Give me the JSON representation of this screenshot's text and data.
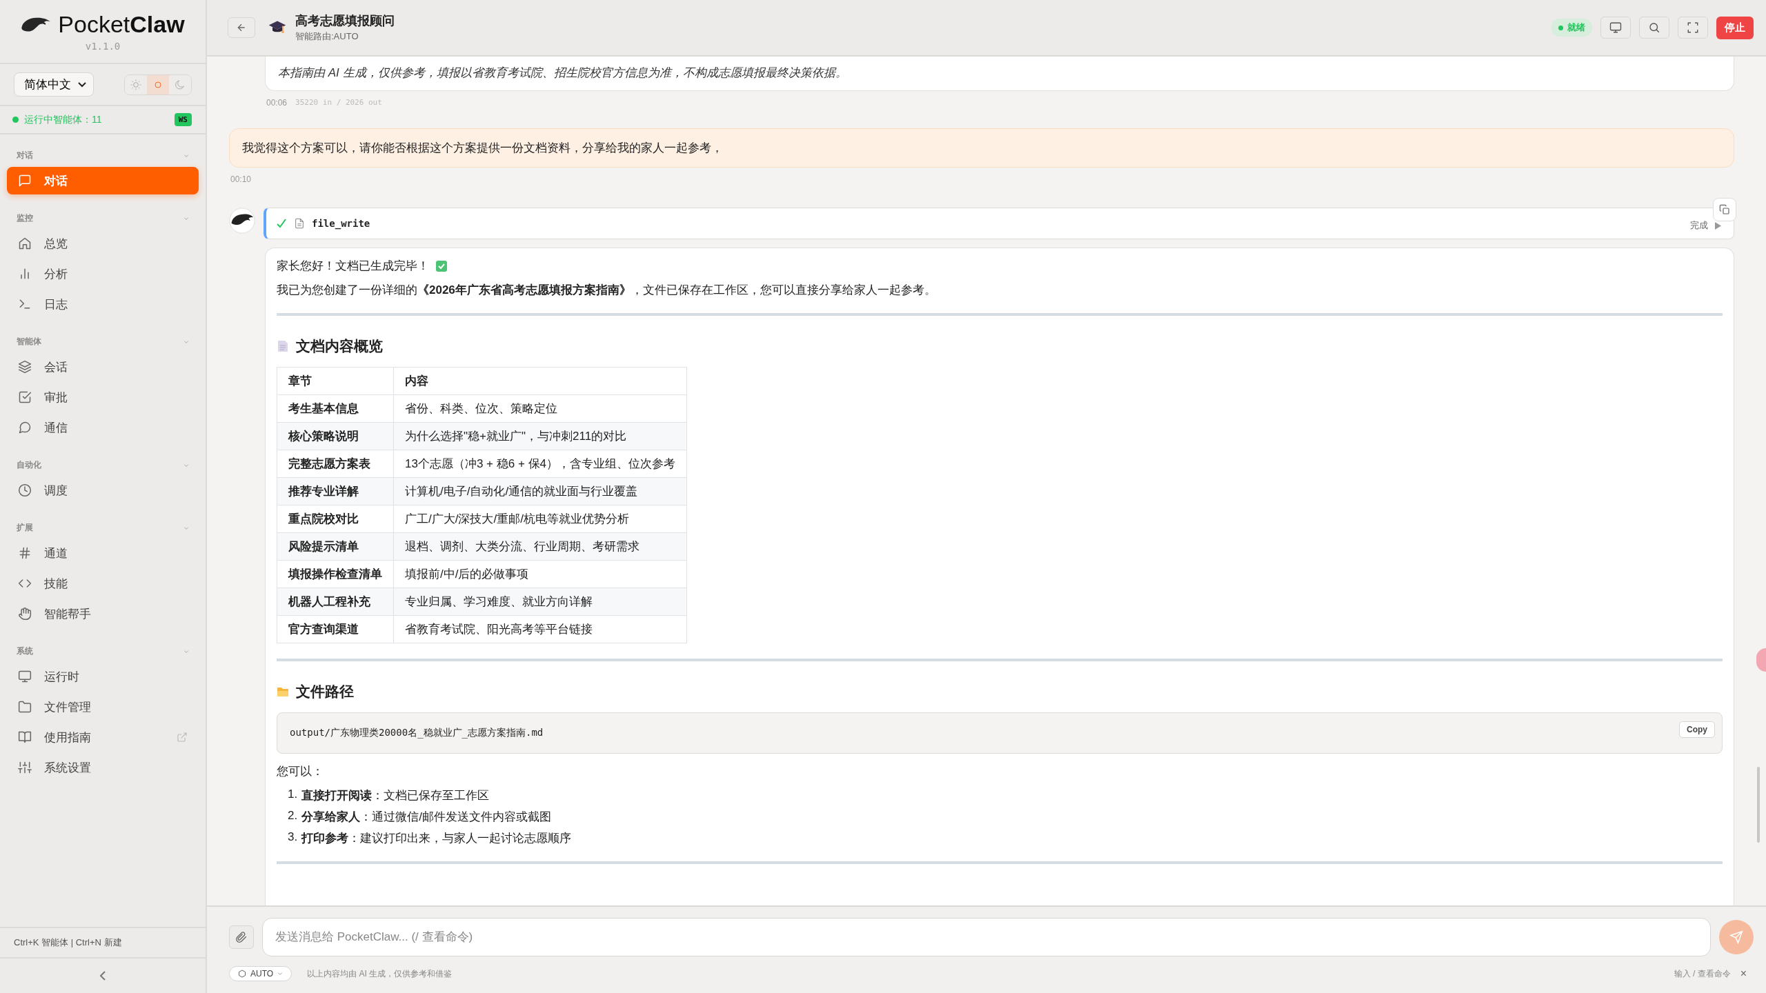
{
  "app": {
    "name_light": "Pocket",
    "name_bold": "Claw",
    "version": "v1.1.0"
  },
  "language": {
    "value": "简体中文"
  },
  "theme_modes": [
    {
      "kind": "light",
      "selected": false
    },
    {
      "kind": "system",
      "selected": true
    },
    {
      "kind": "dark",
      "selected": false
    }
  ],
  "runtime_status": {
    "text": "运行中智能体：11",
    "badge": "WS"
  },
  "sidebar": {
    "sections": [
      {
        "title": "对话",
        "expanded": true,
        "items": [
          {
            "label": "对话",
            "selected": true,
            "external": false
          }
        ]
      },
      {
        "title": "监控",
        "expanded": true,
        "items": [
          {
            "label": "总览",
            "selected": false,
            "external": false
          },
          {
            "label": "分析",
            "selected": false,
            "external": false
          },
          {
            "label": "日志",
            "selected": false,
            "external": false
          }
        ]
      },
      {
        "title": "智能体",
        "expanded": true,
        "items": [
          {
            "label": "会话",
            "selected": false,
            "external": false
          },
          {
            "label": "审批",
            "selected": false,
            "external": false
          },
          {
            "label": "通信",
            "selected": false,
            "external": false
          }
        ]
      },
      {
        "title": "自动化",
        "expanded": true,
        "items": [
          {
            "label": "调度",
            "selected": false,
            "external": false
          }
        ]
      },
      {
        "title": "扩展",
        "expanded": true,
        "items": [
          {
            "label": "通道",
            "selected": false,
            "external": false
          },
          {
            "label": "技能",
            "selected": false,
            "external": false
          },
          {
            "label": "智能帮手",
            "selected": false,
            "external": false
          }
        ]
      },
      {
        "title": "系统",
        "expanded": true,
        "items": [
          {
            "label": "运行时",
            "selected": false,
            "external": false
          },
          {
            "label": "文件管理",
            "selected": false,
            "external": false
          },
          {
            "label": "使用指南",
            "selected": false,
            "external": true
          },
          {
            "label": "系统设置",
            "selected": false,
            "external": false
          }
        ]
      }
    ],
    "shortcuts": "Ctrl+K 智能体 | Ctrl+N 新建"
  },
  "header": {
    "title": "高考志愿填报顾问",
    "subtitle": "智能路由:AUTO",
    "status": "就绪",
    "stop_button": "停止"
  },
  "messages": [
    {
      "kind": "assistant_note",
      "text": "本指南由 AI 生成，仅供参考，填报以省教育考试院、招生院校官方信息为准，不构成志愿填报最终决策依据。",
      "time": "00:06",
      "tokens": "35220 in / 2026 out"
    },
    {
      "kind": "user",
      "text": "我觉得这个方案可以，请你能否根据这个方案提供一份文档资料，分享给我的家人一起参考，",
      "time": "00:10"
    },
    {
      "kind": "tool",
      "name": "file_write",
      "status": "完成",
      "success": true
    },
    {
      "kind": "assistant",
      "greeting": "家长您好！文档已生成完毕！",
      "intro": "我已为您创建了一份详细的**《2026年广东省高考志愿填报方案指南》**，文件已保存在工作区，您可以直接分享给家人一起参考。",
      "overview_heading": "文档内容概览",
      "table": {
        "columns": [
          "章节",
          "内容"
        ],
        "rows": [
          [
            "考生基本信息",
            "省份、科类、位次、策略定位"
          ],
          [
            "核心策略说明",
            "为什么选择\"稳+就业广\"，与冲刺211的对比"
          ],
          [
            "完整志愿方案表",
            "13个志愿（冲3 + 稳6 + 保4），含专业组、位次参考"
          ],
          [
            "推荐专业详解",
            "计算机/电子/自动化/通信的就业面与行业覆盖"
          ],
          [
            "重点院校对比",
            "广工/广大/深技大/重邮/杭电等就业优势分析"
          ],
          [
            "风险提示清单",
            "退档、调剂、大类分流、行业周期、考研需求"
          ],
          [
            "填报操作检查清单",
            "填报前/中/后的必做事项"
          ],
          [
            "机器人工程补充",
            "专业归属、学习难度、就业方向详解"
          ],
          [
            "官方查询渠道",
            "省教育考试院、阳光高考等平台链接"
          ]
        ]
      },
      "path_heading": "文件路径",
      "path": "output/广东物理类20000名_稳就业广_志愿方案指南.md",
      "copy_button": "Copy",
      "options_intro": "您可以：",
      "options": [
        {
          "number": "1.",
          "text": "**直接打开阅读**：文档已保存至工作区"
        },
        {
          "number": "2.",
          "text": "**分享给家人**：通过微信/邮件发送文件内容或截图"
        },
        {
          "number": "3.",
          "text": "**打印参考**：建议打印出来，与家人一起讨论志愿顺序"
        }
      ]
    }
  ],
  "composer": {
    "placeholder": "发送消息给 PocketClaw... (/ 查看命令)",
    "mode": "AUTO",
    "disclaimer": "以上内容均由 AI 生成，仅供参考和借鉴",
    "hint": "输入 / 查看命令",
    "close": "×"
  }
}
